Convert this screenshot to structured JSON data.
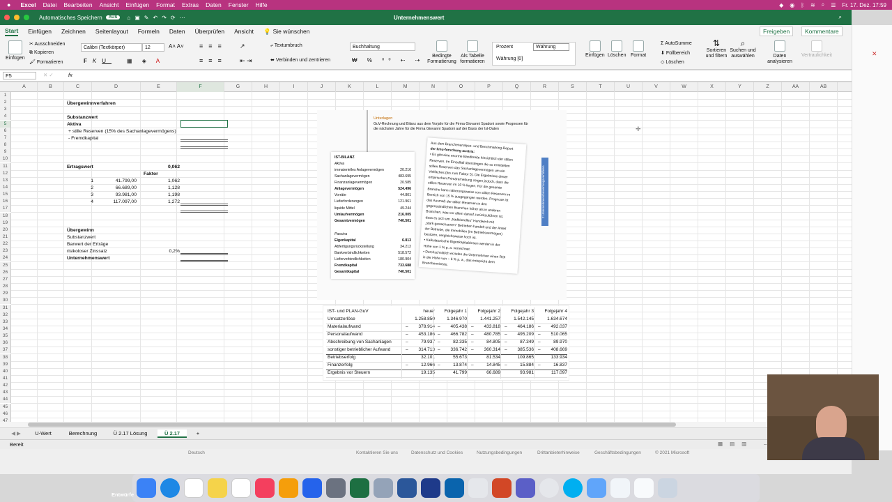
{
  "menubar": {
    "app": "Excel",
    "items": [
      "Datei",
      "Bearbeiten",
      "Ansicht",
      "Einfügen",
      "Format",
      "Extras",
      "Daten",
      "Fenster",
      "Hilfe"
    ],
    "clock": "Fr. 17. Dez.  17:59"
  },
  "titlebar": {
    "autosave": "Automatisches Speichern",
    "toggle": "AUS",
    "title": "Unternehmenswert"
  },
  "tabs": [
    "Start",
    "Einfügen",
    "Zeichnen",
    "Seitenlayout",
    "Formeln",
    "Daten",
    "Überprüfen",
    "Ansicht"
  ],
  "tell_me": "Sie wünschen",
  "share": "Freigeben",
  "comments": "Kommentare",
  "ribbon": {
    "paste": "Einfügen",
    "cut": "Ausschneiden",
    "copy": "Kopieren",
    "format_painter": "Formatieren",
    "font": "Calibri (Textkörper)",
    "size": "12",
    "wrap": "Textumbruch",
    "merge": "Verbinden und zentrieren",
    "numfmt": "Buchhaltung",
    "cond_fmt": "Bedingte Formatierung",
    "as_table": "Als Tabelle formatieren",
    "style1": "Prozent",
    "style2": "Währung",
    "style3": "Währung [0]",
    "insert": "Einfügen",
    "delete": "Löschen",
    "format": "Format",
    "autosum": "AutoSumme",
    "fill": "Füllbereich",
    "clear": "Löschen",
    "sort": "Sortieren und filtern",
    "find": "Suchen und auswählen",
    "analyze": "Daten analysieren",
    "sensitivity": "Vertraulichkeit"
  },
  "namebox": "F5",
  "fx": "fx",
  "columns": [
    "A",
    "B",
    "C",
    "D",
    "E",
    "F",
    "G",
    "H",
    "I",
    "J",
    "K",
    "L",
    "M",
    "N",
    "O",
    "P",
    "Q",
    "R",
    "S",
    "T",
    "U",
    "V",
    "W",
    "X",
    "Y",
    "Z",
    "AA",
    "AB"
  ],
  "sheet": {
    "c2": "Übergewinnverfahren",
    "c4": "Substanzwert",
    "c5": "Aktiva",
    "c6": "+ stille Reserven (15% des Sachanlagevermögens)",
    "c7": "- Fremdkapital",
    "c11": "Ertragswert",
    "e11": "0,062",
    "e12": "Faktor",
    "rows": [
      {
        "c": "1",
        "d": "41.799,00",
        "e": "1,062"
      },
      {
        "c": "2",
        "d": "66.689,00",
        "e": "1,128"
      },
      {
        "c": "3",
        "d": "93.981,00",
        "e": "1,198"
      },
      {
        "c": "4",
        "d": "117.097,00",
        "e": "1,272"
      }
    ],
    "c20": "Übergewinn",
    "c21": "Substanzwert",
    "c22": "Barwert der Erträge",
    "c23": "risikoloser Zinssatz",
    "e23": "0,2%",
    "c24": "Unternehmenswert"
  },
  "doc1": {
    "heading": "Unterlagen",
    "intro1": "GuV-Rechnung und Bilanz aus dem Vorjahr für die Firma Giovanni Spadoni sowie Prognosen für",
    "intro2": "die nächsten Jahre für die Firma Giovanni Spadoni auf der Basis der Ist-Daten",
    "bilanz_title": "IST-BILANZ",
    "aktiva": "Aktiva",
    "aktiva_rows": [
      {
        "l": "immaterielles Anlagevermögen",
        "v": "20.216"
      },
      {
        "l": "Sachanlagevermögen",
        "v": "483.695"
      },
      {
        "l": "Finanzanlagevermögen",
        "v": "20.585"
      },
      {
        "l": "Anlagevermögen",
        "v": "524.496",
        "b": true
      },
      {
        "l": "Vorräte",
        "v": "44.801"
      },
      {
        "l": "Lieferforderungen",
        "v": "121.961"
      },
      {
        "l": "liquide Mittel",
        "v": "49.244"
      },
      {
        "l": "Umlaufvermögen",
        "v": "216.005",
        "b": true
      },
      {
        "l": "Gesamtvermögen",
        "v": "740.501",
        "b": true
      }
    ],
    "passiva": "Passiva",
    "passiva_rows": [
      {
        "l": "Eigenkapital",
        "v": "6.813",
        "b": true
      },
      {
        "l": "Abfertigungsrückstellung",
        "v": "34.212"
      },
      {
        "l": "Bankverbindlichkeiten",
        "v": "518.572"
      },
      {
        "l": "Lieferverbindlichkeiten",
        "v": "180.904"
      },
      {
        "l": "Fremdkapital",
        "v": "733.688",
        "b": true
      },
      {
        "l": "Gesamtkapital",
        "v": "740.501",
        "b": true
      }
    ],
    "note_lines": [
      "Aus dem Branchenanalyse- und Benchmarking-Report",
      "der kmu-forschung austria:",
      "• Es gibt eine enorme Bandbreite hinsichtlich der stillen",
      "  Reserven. Im Einzelfall übersteigen die so ermittelten",
      "  stillen Reserven das Sachanlagevermögen um ein",
      "  Vielfaches (bis zum Faktor 5). Die Ergebnisse dieser",
      "  empirischen Primärerhebung zeigen jedoch, dass die",
      "  stillen Reserven im 10 % liegen. Für die gesamte",
      "  Branche kann näherungsweise von stillen Reserven im",
      "  Bereich von 15 % ausgegangen werden. Prognose ist",
      "  das Ausmaß der stillen Reserven in den",
      "  gegenständlichen Branchen höher als in anderen",
      "  Branchen, was vor allem darauf zurückzuführen ist,",
      "  dass es sich um „traditionelles\" Handwerk mit",
      "  „stark gewachsenen\" Betrieben handelt und der Anteil",
      "  der Betriebe, die Immobilien (im Betriebsvermögen)",
      "  besitzen, vergleichsweise hoch ist.",
      "• Kalkulatorische Eigenkapitalzinsen werden in der",
      "  Höhe von 1 % p. a. verrechnet.",
      "• Durchschnittlich erzielen die Unternehmen einen ROI",
      "  in der Höhe von ~ 6 % p. a., das entspricht dem",
      "  Branchenniveau."
    ],
    "side_label": "2 Unternehmensbewertungsverfahren"
  },
  "guv": {
    "headers": [
      "IST- und PLAN-GuV",
      "heuer",
      "Folgejahr 1",
      "Folgejahr 2",
      "Folgejahr 3",
      "Folgejahr 4"
    ],
    "rows": [
      {
        "l": "Umsatzerlöse",
        "s": "",
        "v": [
          "1.258.850",
          "1.346.970",
          "1.441.257",
          "1.542.145",
          "1.634.674"
        ]
      },
      {
        "l": "Materialaufwand",
        "s": "–",
        "v": [
          "378.914",
          "405.438",
          "433.818",
          "464.186",
          "492.037"
        ]
      },
      {
        "l": "Personalaufwand",
        "s": "–",
        "v": [
          "453.186",
          "466.782",
          "480.785",
          "495.209",
          "510.065"
        ]
      },
      {
        "l": "Abschreibung von Sachanlagen",
        "s": "–",
        "v": [
          "79.937",
          "82.335",
          "84.805",
          "87.349",
          "89.970"
        ]
      },
      {
        "l": "sonstiger betrieblicher Aufwand",
        "s": "–",
        "v": [
          "314.713",
          "336.742",
          "360.314",
          "385.536",
          "408.669"
        ]
      },
      {
        "l": "Betriebserfolg",
        "s": "",
        "v": [
          "32.101",
          "55.673",
          "81.534",
          "109.865",
          "133.934"
        ]
      },
      {
        "l": "Finanzerfolg",
        "s": "–",
        "v": [
          "12.966",
          "13.874",
          "14.845",
          "15.884",
          "16.837"
        ]
      },
      {
        "l": "Ergebnis vor Steuern",
        "s": "",
        "v": [
          "19.135",
          "41.799",
          "66.689",
          "93.981",
          "117.097"
        ]
      }
    ]
  },
  "sheet_tabs": [
    "U-Wert",
    "Berechnung",
    "Ü 2.17 Lösung",
    "Ü 2.17"
  ],
  "active_sheet": "Ü 2.17",
  "status": "Bereit",
  "footer_links": [
    "Deutsch",
    "Kontaktieren Sie uns",
    "Datenschutz und Cookies",
    "Nutzungsbedingungen",
    "Drittanbieterhinweise",
    "Geschäftsbedingungen",
    "© 2021 Microsoft"
  ],
  "dock_label": "Entwürfe"
}
